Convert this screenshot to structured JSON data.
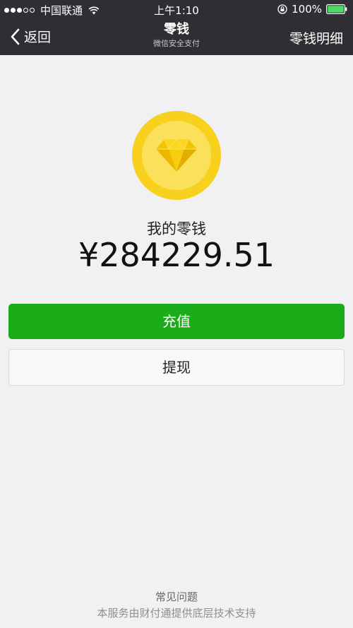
{
  "status_bar": {
    "carrier": "中国联通",
    "time": "上午1:10",
    "battery": "100%",
    "signal_strength": "3 of 5",
    "icons": [
      "signal-icon",
      "wifi-icon",
      "orientation-lock-icon",
      "battery-icon"
    ]
  },
  "nav": {
    "back_label": "返回",
    "title": "零钱",
    "subtitle": "微信安全支付",
    "detail_label": "零钱明细"
  },
  "wallet": {
    "icon": "diamond-icon",
    "label": "我的零钱",
    "amount": "¥284229.51"
  },
  "actions": {
    "recharge_label": "充值",
    "withdraw_label": "提现"
  },
  "footer": {
    "faq_label": "常见问题",
    "note": "本服务由财付通提供底层技术支持"
  },
  "colors": {
    "top_bar": "#2f2f33",
    "background": "#f1f1f3",
    "primary_button": "#1aad19",
    "coin_outer": "#f8d01e",
    "coin_inner": "#fbe05c",
    "battery": "#4cd964"
  }
}
